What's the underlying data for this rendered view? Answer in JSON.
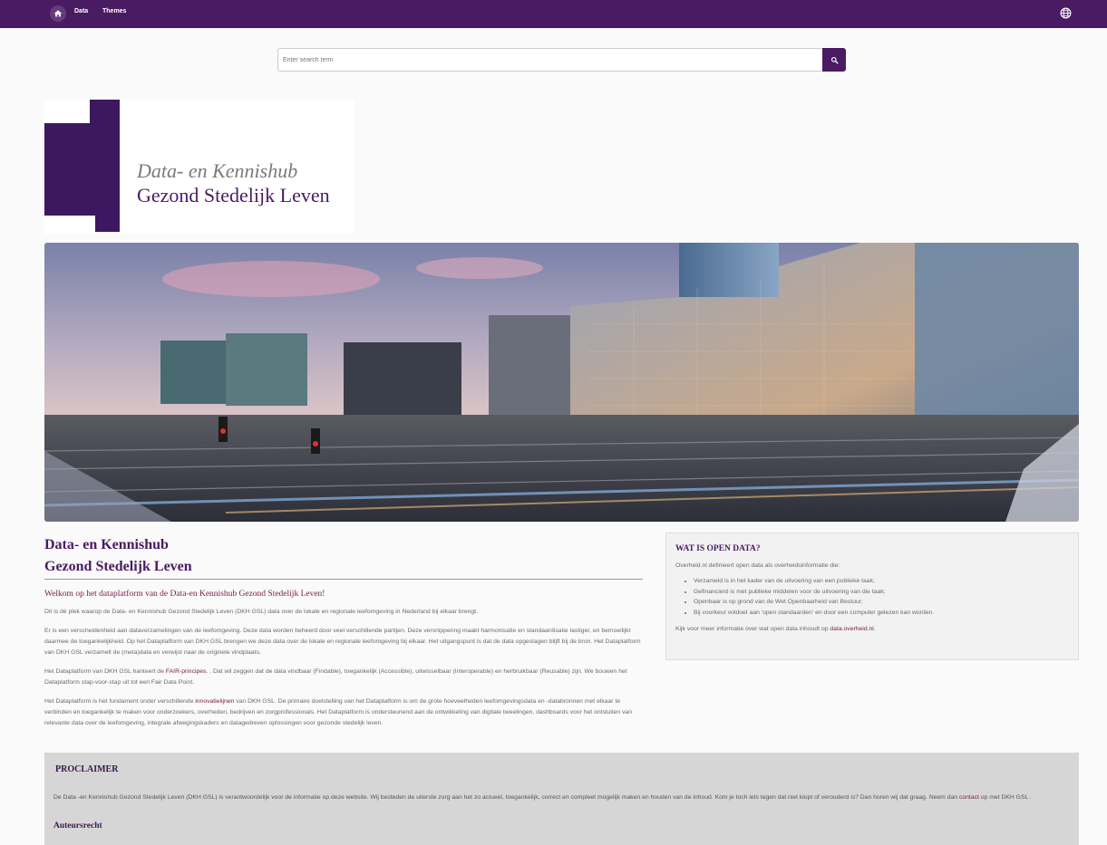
{
  "nav": {
    "items": [
      "Data",
      "Themes"
    ]
  },
  "search": {
    "placeholder": "Enter search term"
  },
  "logo": {
    "line1": "Data- en Kennishub",
    "line2": "Gezond Stedelijk Leven"
  },
  "main": {
    "title_line1": "Data- en Kennishub",
    "title_line2": "Gezond Stedelijk Leven",
    "welcome": "Welkom op het dataplatform van de Data-en Kennishub Gezond Stedelijk Leven!",
    "p1": "Dit is dé plek waarop de Data- en Kennishub Gezond Stedelijk Leven (DKH GSL) data over de lokale en regionale leefomgeving in Nederland bij elkaar brengt.",
    "p2": "Er is een verscheidenheid aan dataverzamelingen van de leefomgeving. Deze data worden beheerd door veel verschillende partijen. Deze versnippering maakt harmonisatie en standaardisatie lastiger, en bemoeilijkt daarmee de toegankelijkheid. Op het Dataplatform van DKH GSL brengen we deze data over de lokale en regionale leefomgeving bij elkaar. Het uitgangspunt is dat de data opgeslagen blijft bij de bron. Het Dataplatform van DKH GSL verzamelt de (meta)data en verwijst naar de originele vindplaats.",
    "p3_before": "Het Dataplatform van DKH GSL hanteert de ",
    "p3_link": "FAIR-principes",
    "p3_after": ". . Dat wil zeggen dat de data vindbaar (Findable), toegankelijk (Accessible), uitwisselbaar (Interoperable) en herbruikbaar (Reusable) zijn. We bouwen het Dataplatform stap-voor-stap uit tot een Fair Data Point.",
    "p4_before": "Het Dataplatform is het fundament onder verschillende ",
    "p4_link": "innovatielijnen",
    "p4_after": " van DKH GSL. De primaire doelstelling van het Dataplatform is om de grote hoeveelheden leefomgevingsdata en -databronnen met elkaar te verbinden en toegankelijk te maken voor onderzoekers, overheden, bedrijven en zorgprofessionals. Het Dataplatform is ondersteunend aan de ontwikkeling van digitale tweelingen, dashboards voor het ontsluiten van relevante data over de leefomgeving, integrale afwegingskaders en datagedreven oplossingen voor gezonde stedelijk leven."
  },
  "side": {
    "title": "WAT IS OPEN DATA?",
    "intro": "Overheid.nl definieert open data als overheidsinformatie die:",
    "items": [
      "Verzameld is in het kader van de uitvoering van een publieke taak;",
      "Gefinancierd is met publieke middelen voor de uitvoering van die taak;",
      "Openbaar is op grond van de Wet Openbaarheid van Bestuur;",
      "Bij voorkeur voldoet aan 'open standaarden' en door een computer gelezen kan worden."
    ],
    "foot_before": "Kijk voor meer informatie over wat open data inhoudt op ",
    "foot_link": "data.overheid.nl",
    "foot_after": "."
  },
  "proclaimer": {
    "title": "PROCLAIMER",
    "text_before": "De Data -en Kennishub Gezond Stedelijk Leven (DKH GSL) is verantwoordelijk voor de informatie op deze website. Wij besteden de uiterste zorg aan het zo actueel, toegankelijk, correct en compleet mogelijk maken en houden van de inhoud. Kom je toch iets tegen dat niet klopt of verouderd is? Dan horen wij dat graag. Neem dan ",
    "text_link": "contact",
    "text_after": " op met DKH GSL .",
    "subtitle": "Auteursrecht"
  },
  "colors": {
    "brand": "#4a1a63",
    "link": "#7a1a4a"
  },
  "icons": {
    "home": "home-icon",
    "language": "globe-icon",
    "search": "search-icon"
  }
}
